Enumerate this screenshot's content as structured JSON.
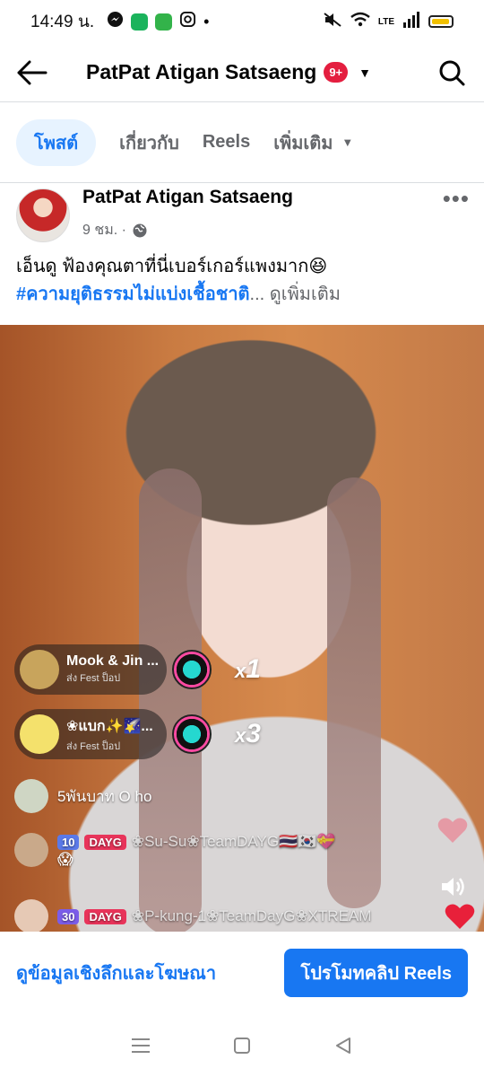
{
  "status_bar": {
    "time": "14:49 น.",
    "apps": [
      "messenger-icon",
      "shield-app-icon",
      "line-icon",
      "instagram-icon"
    ],
    "dot": "•",
    "network_label": "LTE"
  },
  "topnav": {
    "title": "PatPat Atigan Satsaeng",
    "badge": "9+"
  },
  "tabs": [
    {
      "label": "โพสต์"
    },
    {
      "label": "เกี่ยวกับ"
    },
    {
      "label": "Reels"
    },
    {
      "label": "เพิ่มเติม"
    }
  ],
  "post": {
    "author": "PatPat Atigan Satsaeng",
    "time": "9 ชม. ·",
    "caption_line1": "เอ็นดู ฟ้องคุณตาที่นี่เบอร์เกอร์แพงมาก😆",
    "hashtag": "#ความยุติธรรมไม่แบ่งเชื้อชาติ",
    "ellipsis": "...",
    "see_more": "ดูเพิ่มเติม"
  },
  "video": {
    "gifts": [
      {
        "name": "Mook & Jin ...",
        "sub": "ส่ง Fest ป็อป",
        "mult": "x",
        "count": "1"
      },
      {
        "name": "❀แบก✨🌠...",
        "sub": "ส่ง Fest ป็อป",
        "mult": "x",
        "count": "3"
      }
    ],
    "comments": [
      {
        "text": "5พันบาท O ho"
      },
      {
        "level": "10",
        "team": "DAYG",
        "text": "❀Su-Su❀TeamDAYG🇹🇭🇰🇷💝",
        "text2": "😱"
      },
      {
        "level": "30",
        "team": "DAYG",
        "text": "❀P-kung-1❀TeamDayG❀XTREAM"
      }
    ]
  },
  "actions": {
    "insights": "ดูข้อมูลเชิงลึกและโฆษณา",
    "promote": "โปรโมทคลิป Reels"
  },
  "colors": {
    "accent": "#1877f2",
    "badge": "#e41e3f",
    "tab_active_bg": "#e7f3ff"
  }
}
